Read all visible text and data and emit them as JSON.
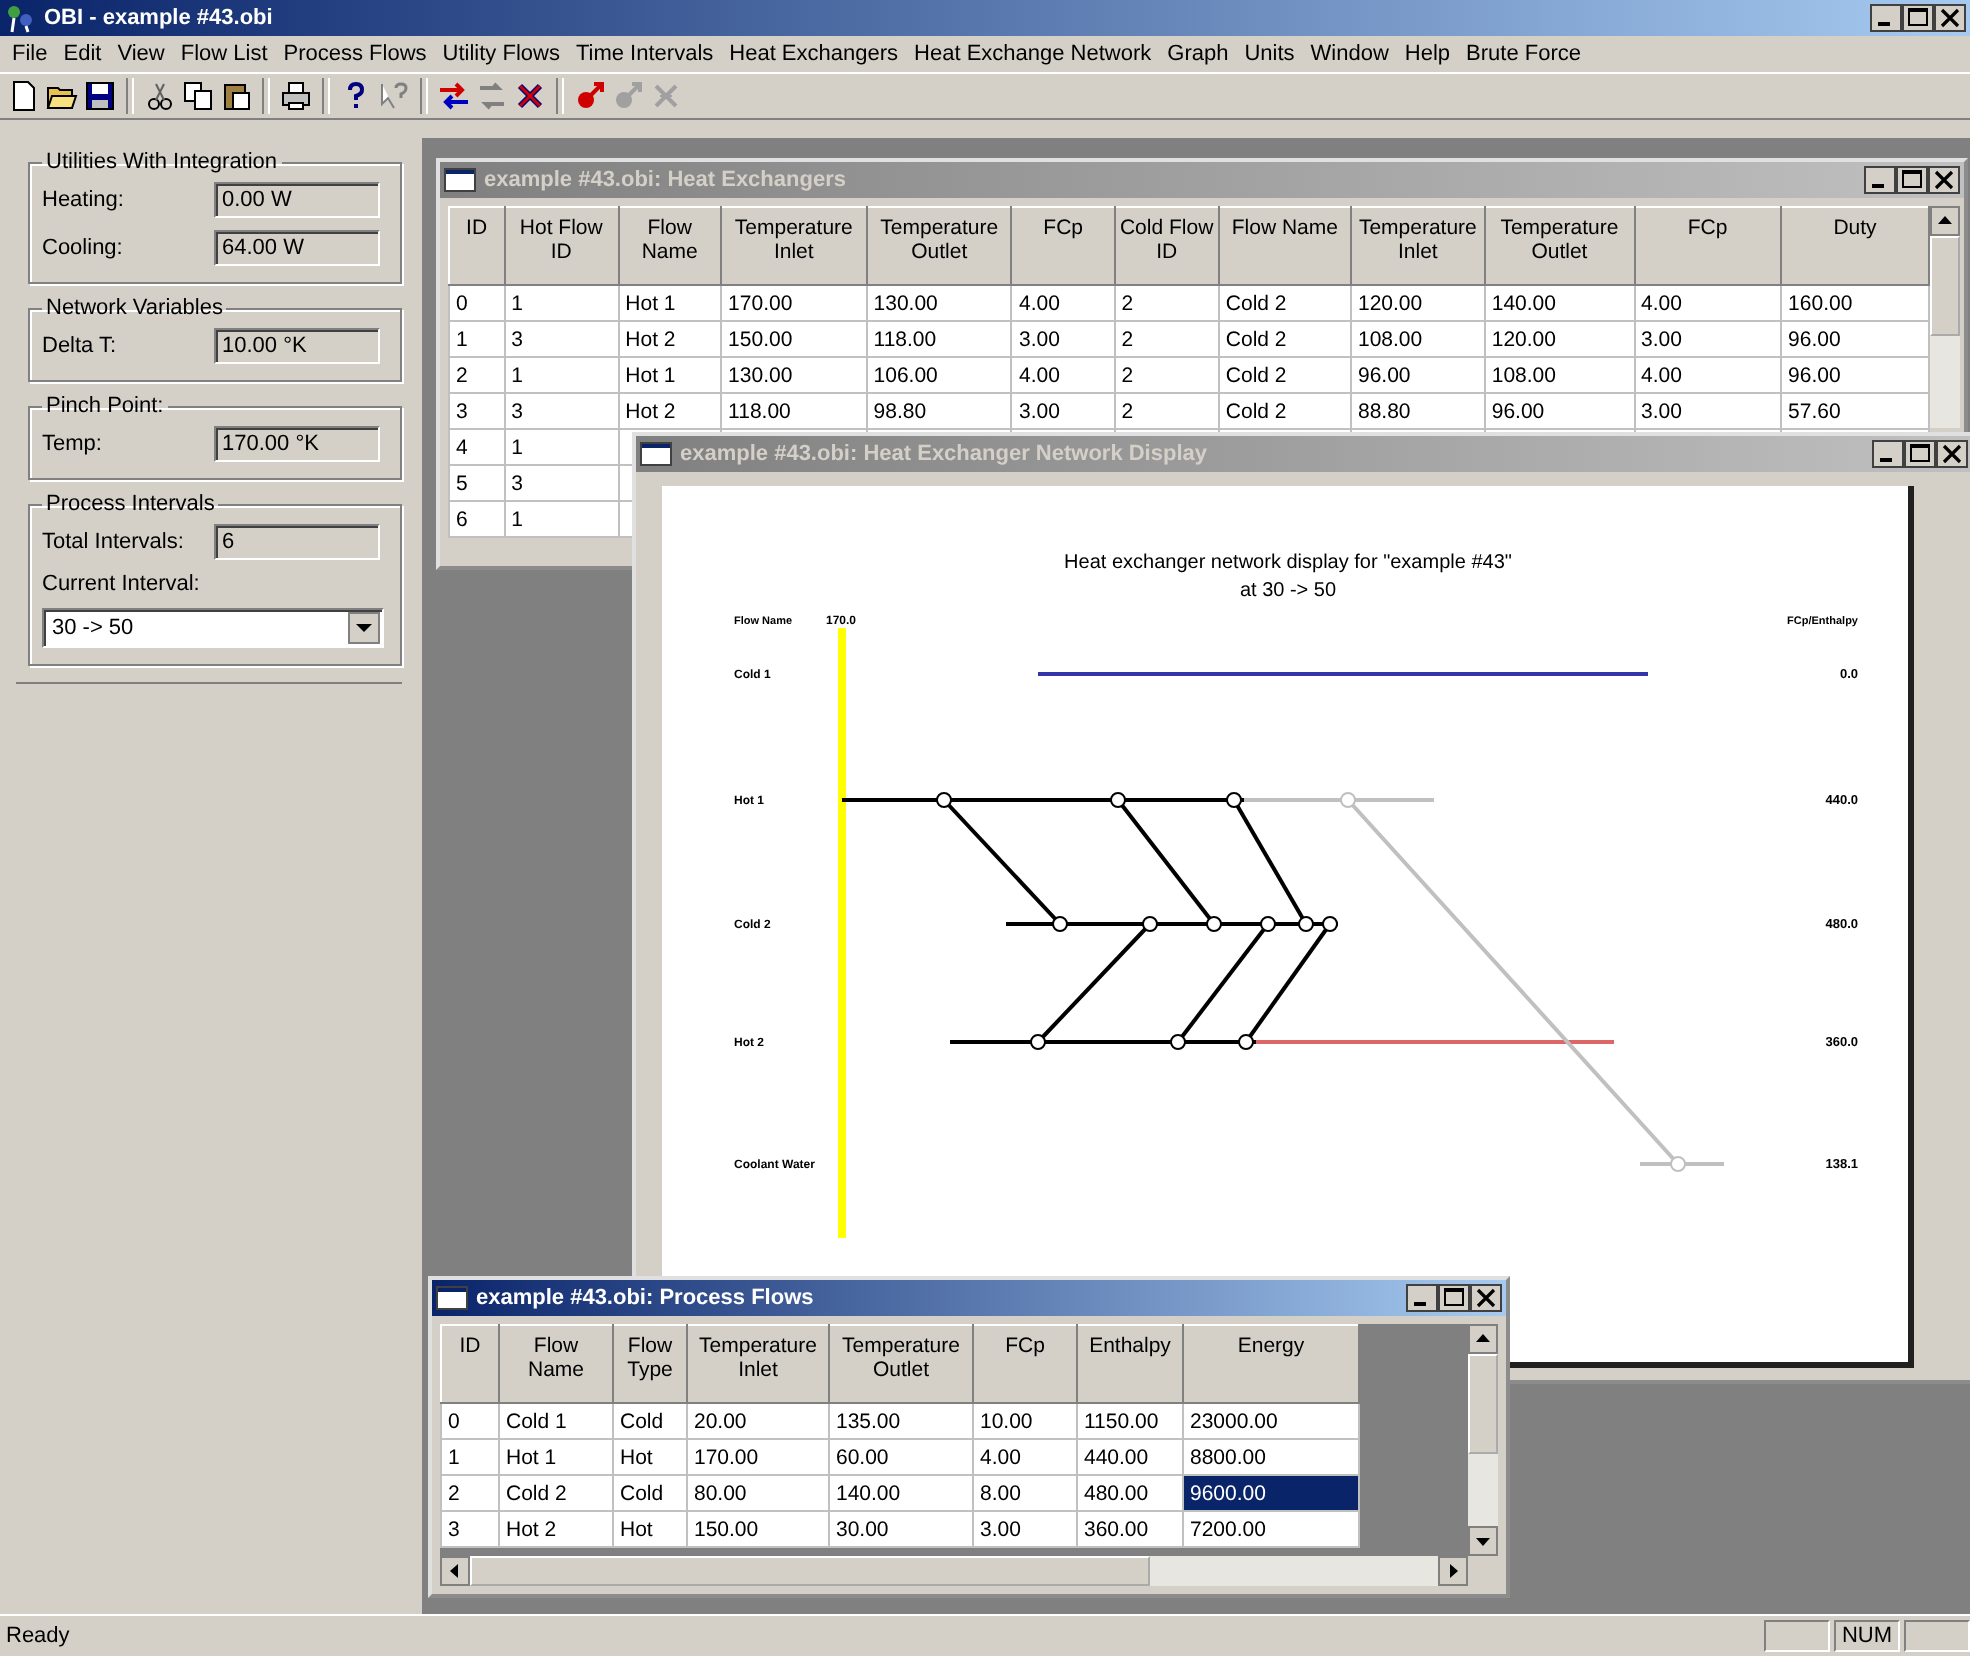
{
  "window": {
    "title": "OBI - example #43.obi"
  },
  "menu": [
    "File",
    "Edit",
    "View",
    "Flow List",
    "Process Flows",
    "Utility Flows",
    "Time Intervals",
    "Heat Exchangers",
    "Heat Exchange Network",
    "Graph",
    "Units",
    "Window",
    "Help",
    "Brute Force"
  ],
  "side_panel": {
    "groups": [
      {
        "title": "Utilities With Integration",
        "fields": [
          {
            "kind": "field",
            "label": "Heating:",
            "value": "0.00 W"
          },
          {
            "kind": "field",
            "label": "Cooling:",
            "value": "64.00 W"
          }
        ]
      },
      {
        "title": "Network Variables",
        "fields": [
          {
            "kind": "field",
            "label": "Delta T:",
            "value": "10.00 °K"
          }
        ]
      },
      {
        "title": "Pinch Point:",
        "fields": [
          {
            "kind": "field",
            "label": "Temp:",
            "value": "170.00 °K"
          }
        ]
      },
      {
        "title": "Process Intervals",
        "fields": [
          {
            "kind": "field",
            "label": "Total Intervals:",
            "value": "6"
          },
          {
            "kind": "dropdown",
            "label": "Current Interval:",
            "value": "30 -> 50"
          }
        ]
      }
    ]
  },
  "heat_exchangers_window": {
    "title": "example #43.obi: Heat Exchangers",
    "active": false,
    "columns": [
      "ID",
      "Hot Flow ID",
      "Flow Name",
      "Temperature Inlet",
      "Temperature Outlet",
      "FCp",
      "Cold Flow ID",
      "Flow Name",
      "Temperature Inlet",
      "Temperature Outlet",
      "FCp",
      "Duty"
    ],
    "rows": [
      [
        "0",
        "1",
        "Hot 1",
        "170.00",
        "130.00",
        "4.00",
        "2",
        "Cold 2",
        "120.00",
        "140.00",
        "4.00",
        "160.00"
      ],
      [
        "1",
        "3",
        "Hot 2",
        "150.00",
        "118.00",
        "3.00",
        "2",
        "Cold 2",
        "108.00",
        "120.00",
        "3.00",
        "96.00"
      ],
      [
        "2",
        "1",
        "Hot 1",
        "130.00",
        "106.00",
        "4.00",
        "2",
        "Cold 2",
        "96.00",
        "108.00",
        "4.00",
        "96.00"
      ],
      [
        "3",
        "3",
        "Hot 2",
        "118.00",
        "98.80",
        "3.00",
        "2",
        "Cold 2",
        "88.80",
        "96.00",
        "3.00",
        "57.60"
      ],
      [
        "4",
        "1"
      ],
      [
        "5",
        "3"
      ],
      [
        "6",
        "1"
      ]
    ]
  },
  "network_window": {
    "title": "example #43.obi: Heat Exchanger Network Display",
    "active": false,
    "diagram": {
      "title": "Heat exchanger network display for \"example #43\"",
      "subtitle": "at 30 -> 50",
      "flow_name_header": "Flow Name",
      "pinch_label": "170.0",
      "fcp_header": "FCp/Enthalpy",
      "streams": [
        {
          "name": "Cold 1",
          "value": "0.0",
          "color": "#3333aa"
        },
        {
          "name": "Hot 1",
          "value": "440.0",
          "color": "#c0c0c0"
        },
        {
          "name": "Cold 2",
          "value": "480.0",
          "color": "#000000"
        },
        {
          "name": "Hot 2",
          "value": "360.0",
          "color": "#dd6666"
        },
        {
          "name": "Coolant Water",
          "value": "138.1",
          "color": "#c0c0c0"
        }
      ]
    }
  },
  "process_flows_window": {
    "title": "example #43.obi: Process Flows",
    "active": true,
    "columns": [
      "ID",
      "Flow Name",
      "Flow Type",
      "Temperature Inlet",
      "Temperature Outlet",
      "FCp",
      "Enthalpy",
      "Energy"
    ],
    "rows": [
      {
        "cells": [
          {
            "text": "0",
            "selected": false
          },
          {
            "text": "Cold 1",
            "selected": false
          },
          {
            "text": "Cold",
            "selected": false
          },
          {
            "text": "20.00",
            "selected": false
          },
          {
            "text": "135.00",
            "selected": false
          },
          {
            "text": "10.00",
            "selected": false
          },
          {
            "text": "1150.00",
            "selected": false
          },
          {
            "text": "23000.00",
            "selected": false
          }
        ]
      },
      {
        "cells": [
          {
            "text": "1",
            "selected": false
          },
          {
            "text": "Hot 1",
            "selected": false
          },
          {
            "text": "Hot",
            "selected": false
          },
          {
            "text": "170.00",
            "selected": false
          },
          {
            "text": "60.00",
            "selected": false
          },
          {
            "text": "4.00",
            "selected": false
          },
          {
            "text": "440.00",
            "selected": false
          },
          {
            "text": "8800.00",
            "selected": false
          }
        ]
      },
      {
        "cells": [
          {
            "text": "2",
            "selected": false
          },
          {
            "text": "Cold 2",
            "selected": false
          },
          {
            "text": "Cold",
            "selected": false
          },
          {
            "text": "80.00",
            "selected": false
          },
          {
            "text": "140.00",
            "selected": false
          },
          {
            "text": "8.00",
            "selected": false
          },
          {
            "text": "480.00",
            "selected": false
          },
          {
            "text": "9600.00",
            "selected": true
          }
        ]
      },
      {
        "cells": [
          {
            "text": "3",
            "selected": false
          },
          {
            "text": "Hot 2",
            "selected": false
          },
          {
            "text": "Hot",
            "selected": false
          },
          {
            "text": "150.00",
            "selected": false
          },
          {
            "text": "30.00",
            "selected": false
          },
          {
            "text": "3.00",
            "selected": false
          },
          {
            "text": "360.00",
            "selected": false
          },
          {
            "text": "7200.00",
            "selected": false
          }
        ]
      }
    ]
  },
  "status_bar": {
    "text": "Ready",
    "panes": [
      "NUM"
    ]
  }
}
